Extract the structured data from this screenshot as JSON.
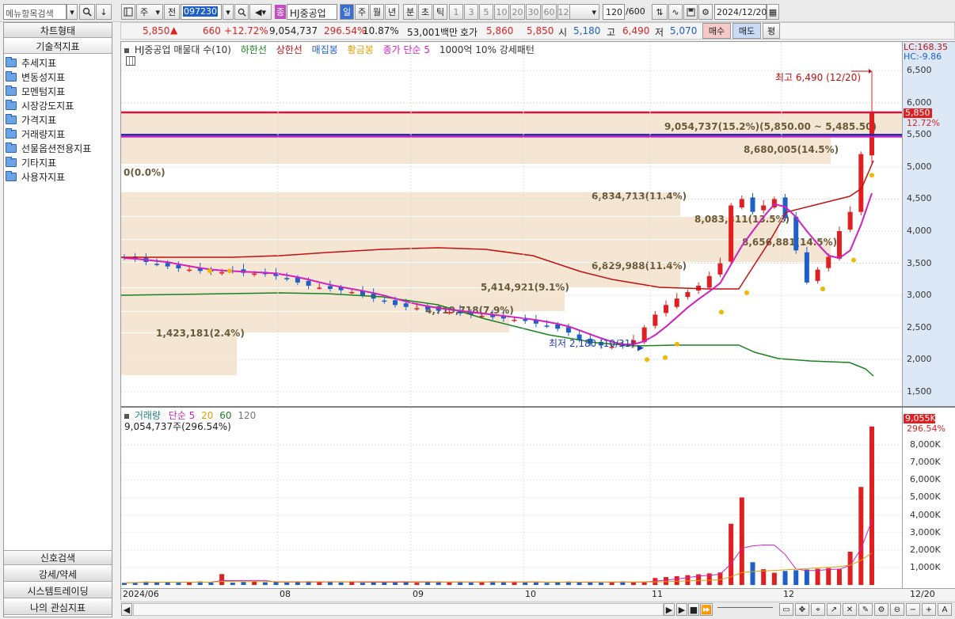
{
  "toolbar": {
    "menu_search_placeholder": "메뉴항목검색",
    "period_weekly": "주",
    "prev": "전",
    "code": "097230",
    "stock_badge": "종",
    "stock_name": "HJ중공업",
    "periods": [
      "일",
      "주",
      "월",
      "년",
      "분",
      "초",
      "틱"
    ],
    "active_period": "일",
    "intervals": [
      "1",
      "3",
      "5",
      "10",
      "20",
      "30",
      "60",
      "120"
    ],
    "count": "120",
    "count_total": "/600",
    "date": "2024/12/20"
  },
  "quote": {
    "price": "5,850",
    "arrow": "▲",
    "change": "660",
    "change_pct": "+12.72%",
    "volume": "9,054,737",
    "volume_pct": "296.54%",
    "turnover": "10.87%",
    "amount": "53,001백만",
    "bid_label": "호가",
    "ask_price": "5,860",
    "bid_price": "5,850",
    "open_label": "시",
    "open": "5,180",
    "high_label": "고",
    "high": "6,490",
    "low_label": "저",
    "low": "5,070",
    "buy": "매수",
    "sell": "매도",
    "eval": "평"
  },
  "sidebar": {
    "tabs": [
      "차트형태",
      "기술적지표"
    ],
    "items": [
      "추세지표",
      "변동성지표",
      "모멘텀지표",
      "시장강도지표",
      "가격지표",
      "거래량지표",
      "선물옵션전용지표",
      "기타지표",
      "사용자지표"
    ],
    "bottom_tabs": [
      "신호검색",
      "강세/약세",
      "시스템트레이딩",
      "나의 관심지표"
    ]
  },
  "legend": {
    "title": "HJ중공업 매물대 수(10)",
    "lower_limit": "하한선",
    "upper_limit": "상한선",
    "bars": "매집봉",
    "gold": "황금봉",
    "close_ma": "종가 단순 5",
    "pattern": "1000억 10% 강세패턴"
  },
  "axis": {
    "lc": "LC:168.35",
    "hc": "HC:-9.86",
    "price_ticks": [
      "6,500",
      "6,000",
      "5,500",
      "5,000",
      "4,500",
      "4,000",
      "3,500",
      "3,000",
      "2,500",
      "2,000",
      "1,500"
    ],
    "current_price": "5,850",
    "current_pct": "12.72%",
    "vol_current": "9,055K",
    "vol_pct": "296.54%",
    "vol_ticks": [
      "8,000K",
      "7,000K",
      "6,000K",
      "5,000K",
      "4,000K",
      "3,000K",
      "2,000K",
      "1,000K"
    ],
    "months": [
      "2024/06",
      "08",
      "09",
      "10",
      "11",
      "12"
    ],
    "last_date": "12/20"
  },
  "annotations": {
    "high": "최고 6,490 (12/20)",
    "low": "최저 2,180 (10/31)"
  },
  "volume_profile": [
    {
      "label": "9,054,737(15.2%)(5,850.00 ~ 5,485.50)"
    },
    {
      "label": "8,680,005(14.5%)"
    },
    {
      "label": "0(0.0%)"
    },
    {
      "label": "6,834,713(11.4%)"
    },
    {
      "label": "8,083,311(13.5%)"
    },
    {
      "label": "8,656,881(14.5%)"
    },
    {
      "label": "6,829,988(11.4%)"
    },
    {
      "label": "5,414,921(9.1%)"
    },
    {
      "label": "4,719,718(7.9%)"
    },
    {
      "label": "1,423,181(2.4%)"
    }
  ],
  "volume_legend": {
    "title": "거래량",
    "ma": "단순 5",
    "p20": "20",
    "p60": "60",
    "p120": "120",
    "value": "9,054,737주(296.54%)"
  },
  "colors": {
    "up": "#e02020",
    "down": "#1f5fc8",
    "ma5": "#d020c0",
    "upper": "#c01010",
    "lower": "#1a8020",
    "band": "#f5e6d3",
    "gold": "#f0b800"
  },
  "chart_data": {
    "type": "candlestick",
    "price_range": [
      1300,
      6700
    ],
    "closes": [
      3580,
      3560,
      3520,
      3480,
      3450,
      3420,
      3400,
      3380,
      3370,
      3360,
      3380,
      3350,
      3340,
      3330,
      3300,
      3250,
      3200,
      3150,
      3120,
      3100,
      3080,
      3050,
      3000,
      2950,
      2900,
      2850,
      2820,
      2800,
      2780,
      2760,
      2740,
      2720,
      2700,
      2680,
      2660,
      2640,
      2620,
      2600,
      2560,
      2520,
      2480,
      2420,
      2300,
      2250,
      2220,
      2200,
      2210,
      2300,
      2500,
      2700,
      2850,
      2950,
      3050,
      3150,
      3300,
      3500,
      4400,
      4500,
      4300,
      4400,
      4500,
      4200,
      3700,
      3200,
      3400,
      3600,
      4000,
      4300,
      5200,
      5850
    ],
    "high_value": 6490,
    "low_value": 2180,
    "volume_max": 9055
  }
}
